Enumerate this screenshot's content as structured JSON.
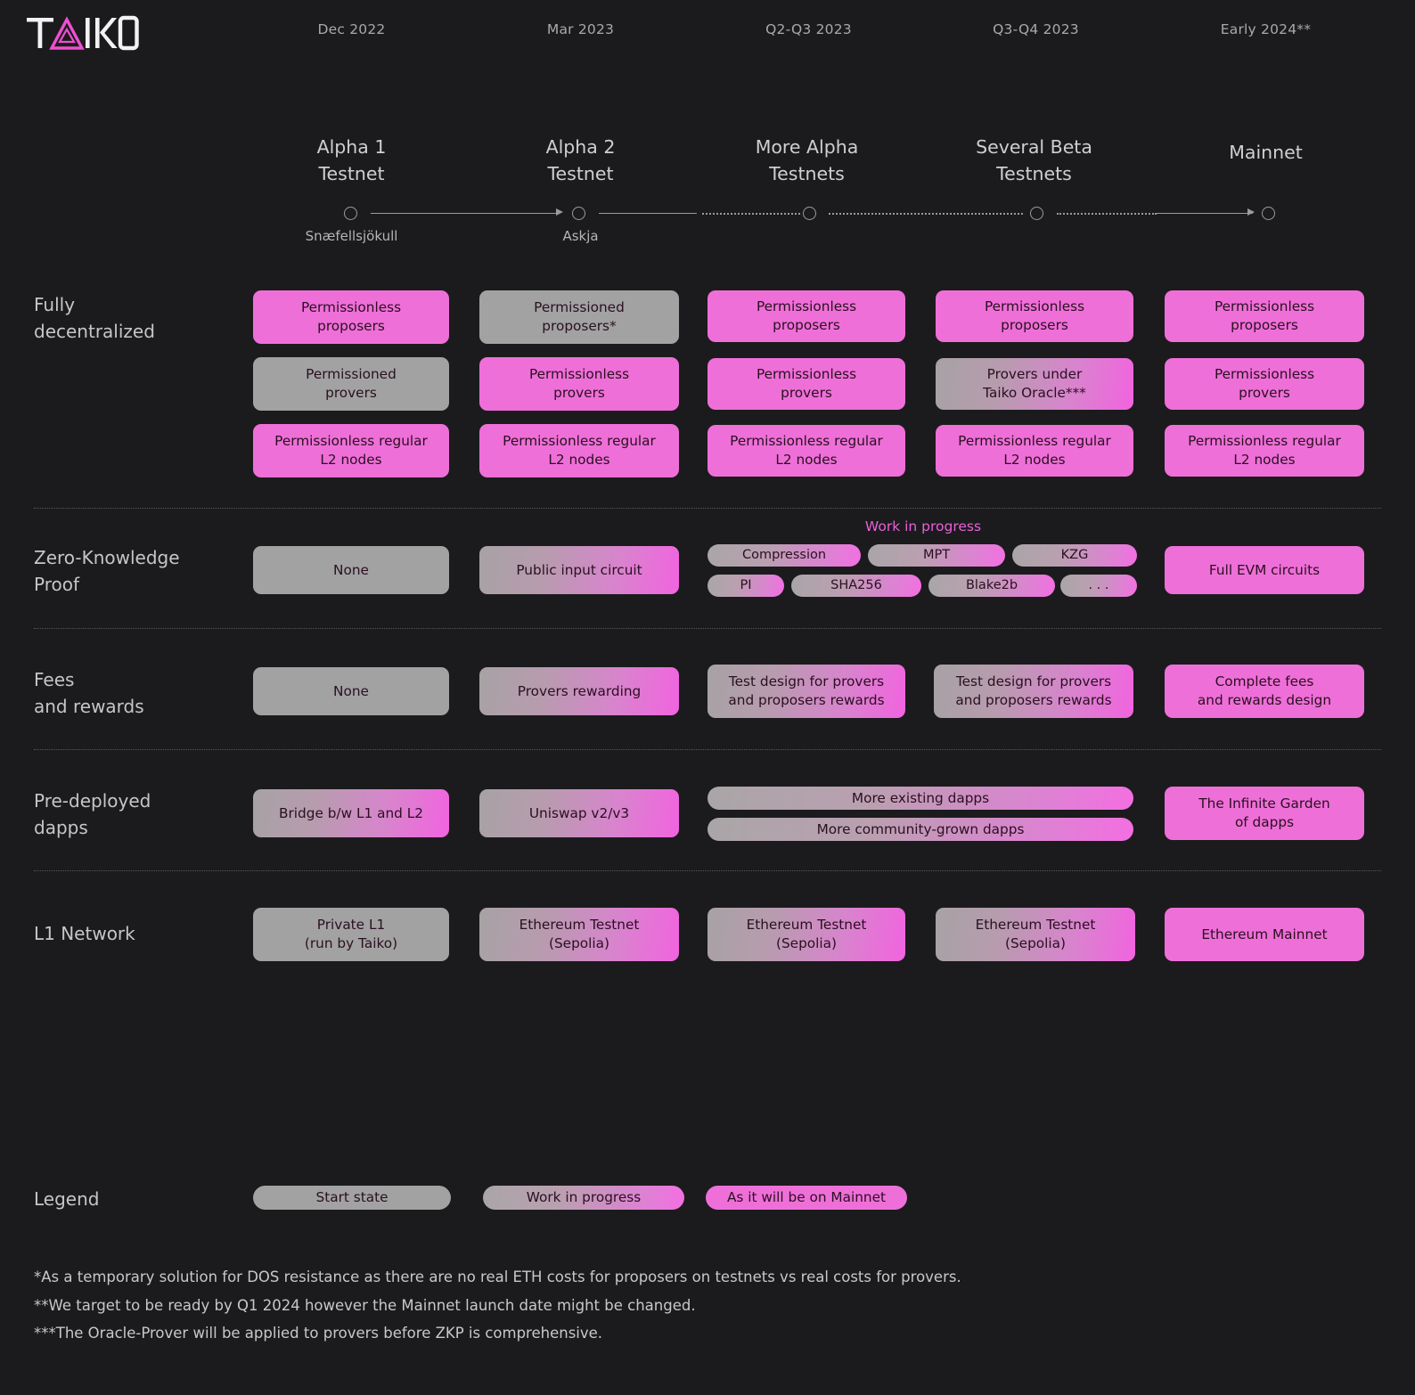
{
  "brand": {
    "name": "TAIKO",
    "accent": "#ef6fd8"
  },
  "colors": {
    "background": "#1b1b1d",
    "pink": "#ef6fd8",
    "gray": "#a2a2a2",
    "text_light": "#c6c6c9",
    "wip_label": "#e95fd8"
  },
  "timeline": {
    "dates": [
      "Dec 2022",
      "Mar 2023",
      "Q2-Q3 2023",
      "Q3-Q4 2023",
      "Early 2024**"
    ],
    "milestones": [
      "Alpha 1\nTestnet",
      "Alpha 2\nTestnet",
      "More Alpha\nTestnets",
      "Several Beta\nTestnets",
      "Mainnet"
    ],
    "sublabels": [
      "Snæfellsjökull",
      "Askja",
      "",
      "",
      ""
    ]
  },
  "rows": [
    {
      "label": "Fully\ndecentralized",
      "columns": [
        [
          {
            "text": "Permissionless\nproposers",
            "state": "mainnet"
          },
          {
            "text": "Permissioned\nprovers",
            "state": "start"
          },
          {
            "text": "Permissionless regular\nL2 nodes",
            "state": "mainnet"
          }
        ],
        [
          {
            "text": "Permissioned\nproposers*",
            "state": "start"
          },
          {
            "text": "Permissionless\nprovers",
            "state": "mainnet"
          },
          {
            "text": "Permissionless regular\nL2 nodes",
            "state": "mainnet"
          }
        ],
        [
          {
            "text": "Permissionless\nproposers",
            "state": "mainnet"
          },
          {
            "text": "Permissionless\nprovers",
            "state": "mainnet"
          },
          {
            "text": "Permissionless regular\nL2 nodes",
            "state": "mainnet"
          }
        ],
        [
          {
            "text": "Permissionless\nproposers",
            "state": "mainnet"
          },
          {
            "text": "Provers under\nTaiko Oracle***",
            "state": "wip"
          },
          {
            "text": "Permissionless regular\nL2 nodes",
            "state": "mainnet"
          }
        ],
        [
          {
            "text": "Permissionless\nproposers",
            "state": "mainnet"
          },
          {
            "text": "Permissionless\nprovers",
            "state": "mainnet"
          },
          {
            "text": "Permissionless regular\nL2 nodes",
            "state": "mainnet"
          }
        ]
      ]
    },
    {
      "label": "Zero-Knowledge\nProof",
      "wip_note": "Work in progress",
      "columns": [
        [
          {
            "text": "None",
            "state": "start"
          }
        ],
        [
          {
            "text": "Public input circuit",
            "state": "wip"
          }
        ],
        [
          {
            "text": "Compression",
            "state": "wip"
          },
          {
            "text": "MPT",
            "state": "wip"
          },
          {
            "text": "KZG",
            "state": "wip"
          },
          {
            "text": "PI",
            "state": "wip"
          },
          {
            "text": "SHA256",
            "state": "wip"
          },
          {
            "text": "Blake2b",
            "state": "wip"
          },
          {
            "text": ". . .",
            "state": "wip"
          }
        ],
        [],
        [
          {
            "text": "Full EVM circuits",
            "state": "mainnet"
          }
        ]
      ]
    },
    {
      "label": "Fees\nand rewards",
      "columns": [
        [
          {
            "text": "None",
            "state": "start"
          }
        ],
        [
          {
            "text": "Provers rewarding",
            "state": "wip"
          }
        ],
        [
          {
            "text": "Test design for provers\nand proposers rewards",
            "state": "wip"
          }
        ],
        [
          {
            "text": "Test design for provers\nand proposers rewards",
            "state": "wip"
          }
        ],
        [
          {
            "text": "Complete fees\nand rewards design",
            "state": "mainnet"
          }
        ]
      ]
    },
    {
      "label": "Pre-deployed\ndapps",
      "columns": [
        [
          {
            "text": "Bridge b/w L1 and L2",
            "state": "wip"
          }
        ],
        [
          {
            "text": "Uniswap v2/v3",
            "state": "wip"
          }
        ],
        [
          {
            "text": "More existing dapps",
            "state": "wip"
          },
          {
            "text": "More community-grown dapps",
            "state": "wip"
          }
        ],
        [],
        [
          {
            "text": "The Infinite Garden\nof dapps",
            "state": "mainnet"
          }
        ]
      ]
    },
    {
      "label": "L1 Network",
      "columns": [
        [
          {
            "text": "Private L1\n(run by Taiko)",
            "state": "start"
          }
        ],
        [
          {
            "text": "Ethereum Testnet\n(Sepolia)",
            "state": "wip"
          }
        ],
        [
          {
            "text": "Ethereum Testnet\n(Sepolia)",
            "state": "wip"
          }
        ],
        [
          {
            "text": "Ethereum Testnet\n(Sepolia)",
            "state": "wip"
          }
        ],
        [
          {
            "text": "Ethereum Mainnet",
            "state": "mainnet"
          }
        ]
      ]
    }
  ],
  "legend": {
    "label": "Legend",
    "items": [
      {
        "text": "Start state",
        "state": "start"
      },
      {
        "text": "Work in progress",
        "state": "wip"
      },
      {
        "text": "As it will be on Mainnet",
        "state": "mainnet"
      }
    ]
  },
  "footnotes": [
    "*As a temporary solution for DOS resistance as there are no real ETH costs for proposers on testnets vs real costs for provers.",
    "**We target to be ready by Q1 2024 however the Mainnet launch date might be changed.",
    "***The Oracle-Prover will be applied to provers before ZKP is comprehensive."
  ]
}
